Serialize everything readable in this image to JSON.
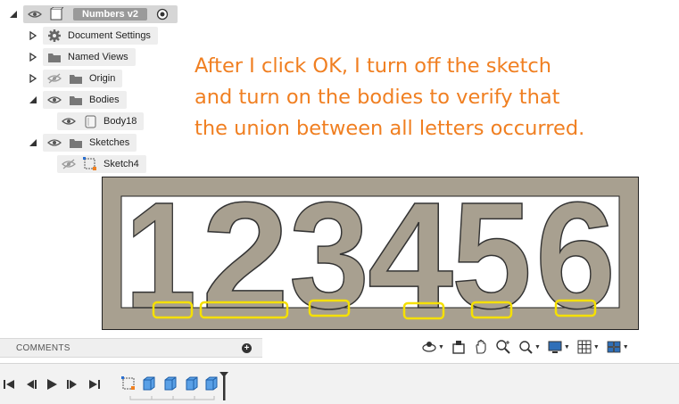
{
  "browser": {
    "root": {
      "label": "Numbers v2"
    },
    "items": [
      {
        "label": "Document Settings"
      },
      {
        "label": "Named Views"
      },
      {
        "label": "Origin"
      },
      {
        "label": "Bodies"
      },
      {
        "label": "Body18"
      },
      {
        "label": "Sketches"
      },
      {
        "label": "Sketch4"
      }
    ]
  },
  "annotation": {
    "lines": [
      "After I click OK, I turn off the sketch",
      "and turn on the bodies to verify that",
      "the union between all letters occurred."
    ],
    "color": "#f07f21"
  },
  "viewport": {
    "digits": [
      "1",
      "2",
      "3",
      "4",
      "5",
      "6"
    ],
    "body_color": "#a8a090",
    "highlight_color": "#f5e000"
  },
  "comments": {
    "title": "COMMENTS",
    "add_symbol": "+"
  },
  "navbar": {
    "tools": [
      "orbit",
      "look-at",
      "pan",
      "zoom",
      "fit",
      "display-settings",
      "grid",
      "viewports"
    ]
  },
  "timeline": {
    "controls": [
      "go-to-start",
      "step-back",
      "play",
      "step-forward",
      "go-to-end"
    ],
    "features": [
      "sketch",
      "extrude",
      "extrude",
      "extrude",
      "extrude"
    ]
  }
}
